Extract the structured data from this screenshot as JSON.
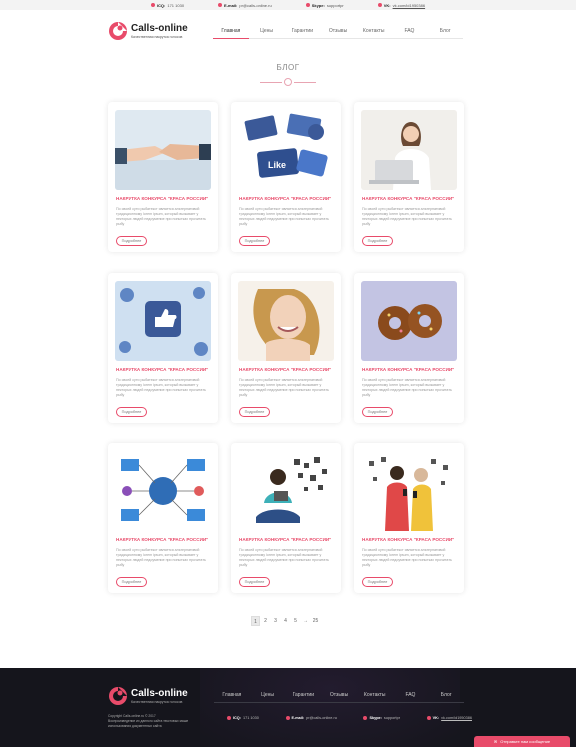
{
  "topbar": {
    "icq_label": "ICQ:",
    "icq_value": "171 1030",
    "email_label": "E-mail:",
    "email_value": "pr@calls-online.ru",
    "skype_label": "Skype:",
    "skype_value": "supportpr",
    "vk_label": "VK:",
    "vk_value": "vk.com/id1950386",
    "icon_color": "#e84b6a"
  },
  "header": {
    "brand": "Calls-online",
    "tagline": "Качественная накрутка голосов",
    "nav": [
      "Главная",
      "Цены",
      "Гарантии",
      "Отзывы",
      "Контакты",
      "FAQ",
      "Блог"
    ],
    "active_nav": "Главная"
  },
  "section_title": "БЛОГ",
  "cards": [
    {
      "title": "НАКРУТКА КОНКУРСА \"КРАСА РОССИИ\"",
      "text": "По своей сути рыбатекст является альтернативой традиционному lorem ipsum, который вызывает у некторых людей недоумение при попытках прочитать рыбу",
      "button": "Подробнее",
      "image_icon": "handshake-photo"
    },
    {
      "title": "НАКРУТКА КОНКУРСА \"КРАСА РОССИИ\"",
      "text": "По своей сути рыбатекст является альтернативой традиционному lorem ipsum, который вызывает у некторых людей недоумение при попытках прочитать рыбу",
      "button": "Подробнее",
      "image_icon": "social-likes-photo"
    },
    {
      "title": "НАКРУТКА КОНКУРСА \"КРАСА РОССИИ\"",
      "text": "По своей сути рыбатекст является альтернативой традиционному lorem ipsum, который вызывает у некторых людей недоумение при попытках прочитать рыбу",
      "button": "Подробнее",
      "image_icon": "woman-laptop-photo"
    },
    {
      "title": "НАКРУТКА КОНКУРСА \"КРАСА РОССИИ\"",
      "text": "По своей сути рыбатекст является альтернативой традиционному lorem ipsum, который вызывает у некторых людей недоумение при попытках прочитать рыбу",
      "button": "Подробнее",
      "image_icon": "thumbs-up-photo"
    },
    {
      "title": "НАКРУТКА КОНКУРСА \"КРАСА РОССИИ\"",
      "text": "По своей сути рыбатекст является альтернативой традиционному lorem ipsum, который вызывает у некторых людей недоумение при попытках прочитать рыбу",
      "button": "Подробнее",
      "image_icon": "smiling-woman-photo"
    },
    {
      "title": "НАКРУТКА КОНКУРСА \"КРАСА РОССИИ\"",
      "text": "По своей сути рыбатекст является альтернативой традиционному lorem ipsum, который вызывает у некторых людей недоумение при попытках прочитать рыбу",
      "button": "Подробнее",
      "image_icon": "donuts-photo"
    },
    {
      "title": "НАКРУТКА КОНКУРСА \"КРАСА РОССИИ\"",
      "text": "По своей сути рыбатекст является альтернативой традиционному lorem ipsum, который вызывает у некторых людей недоумение при попытках прочитать рыбу",
      "button": "Подробнее",
      "image_icon": "network-devices-photo"
    },
    {
      "title": "НАКРУТКА КОНКУРСА \"КРАСА РОССИИ\"",
      "text": "По своей сути рыбатекст является альтернативой традиционному lorem ipsum, который вызывает у некторых людей недоумение при попытках прочитать рыбу",
      "button": "Подробнее",
      "image_icon": "girl-tablet-photo"
    },
    {
      "title": "НАКРУТКА КОНКУРСА \"КРАСА РОССИИ\"",
      "text": "По своей сути рыбатекст является альтернативой традиционному lorem ipsum, который вызывает у некторых людей недоумение при попытках прочитать рыбу",
      "button": "Подробнее",
      "image_icon": "couple-phones-photo"
    }
  ],
  "pagination": {
    "pages": [
      "1",
      "2",
      "3",
      "4",
      "5",
      "→",
      "25"
    ],
    "current": "1"
  },
  "footer": {
    "brand": "Calls-online",
    "tagline": "Качественная накрутка голосов",
    "copyright": "Copyright Calls-online.ru © 2017",
    "copyright_note": "Воспроизведение их данного сайта текстовых маше использования документных сайта",
    "nav": [
      "Главная",
      "Цены",
      "Гарантии",
      "Отзывы",
      "Контакты",
      "FAQ",
      "Блог"
    ],
    "icq_label": "ICQ:",
    "icq_value": "171 1030",
    "email_label": "E-mail:",
    "email_value": "pr@calls-online.ru",
    "skype_label": "Skype:",
    "skype_value": "supportpr",
    "vk_label": "VK:",
    "vk_value": "vk.com/id1950386"
  },
  "message_button": "Отправьте нам сообщение",
  "accent_color": "#e84b6a",
  "footer_bg": "#15151c"
}
